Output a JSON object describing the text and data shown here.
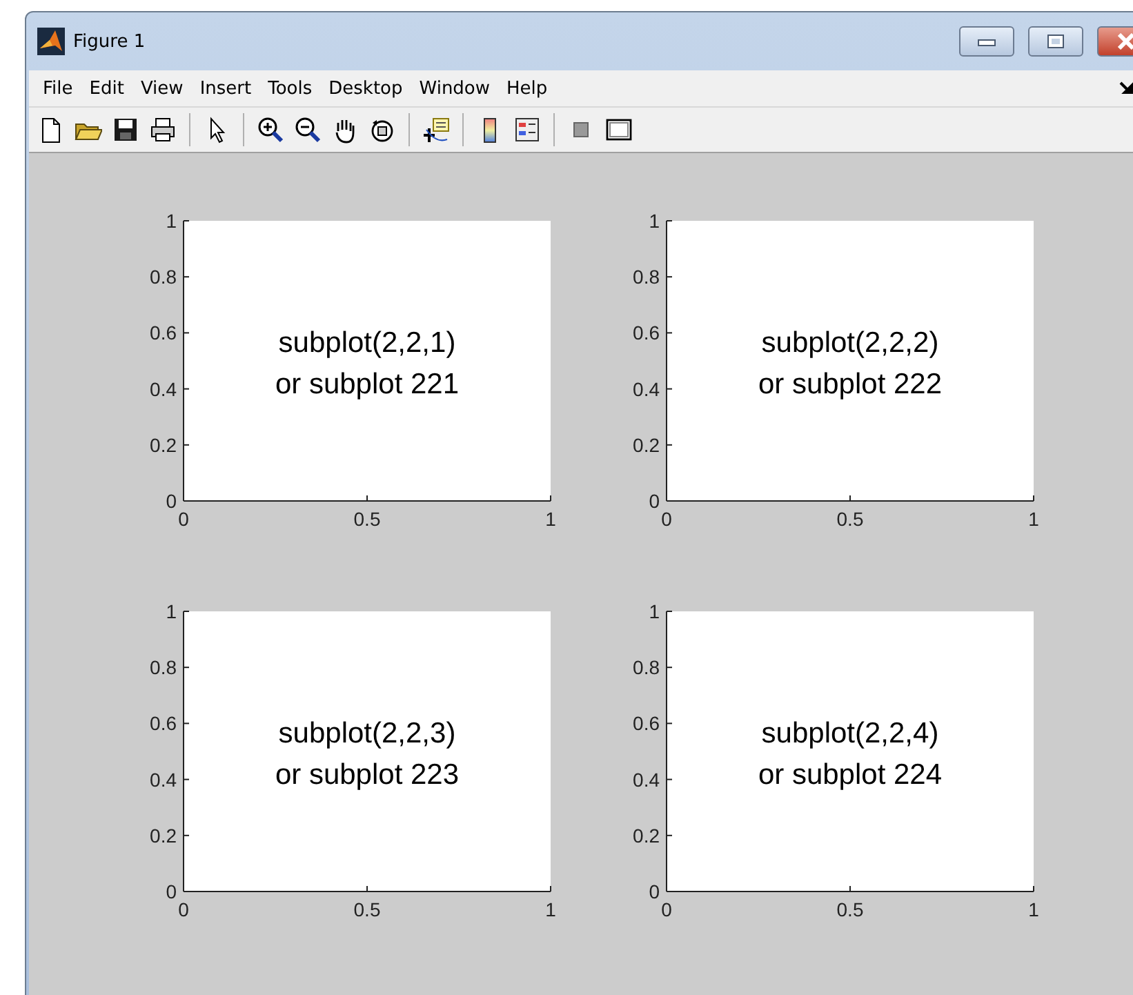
{
  "window": {
    "title": "Figure 1"
  },
  "menu": [
    "File",
    "Edit",
    "View",
    "Insert",
    "Tools",
    "Desktop",
    "Window",
    "Help"
  ],
  "axes": [
    {
      "chart_data": {
        "type": "line",
        "xlim": [
          0,
          1
        ],
        "ylim": [
          0,
          1
        ],
        "xticks": [
          0,
          0.5,
          1
        ],
        "yticks": [
          0,
          0.2,
          0.4,
          0.6,
          0.8,
          1
        ],
        "annotations": [
          "subplot(2,2,1)",
          "or subplot 221"
        ]
      }
    },
    {
      "chart_data": {
        "type": "line",
        "xlim": [
          0,
          1
        ],
        "ylim": [
          0,
          1
        ],
        "xticks": [
          0,
          0.5,
          1
        ],
        "yticks": [
          0,
          0.2,
          0.4,
          0.6,
          0.8,
          1
        ],
        "annotations": [
          "subplot(2,2,2)",
          "or subplot 222"
        ]
      }
    },
    {
      "chart_data": {
        "type": "line",
        "xlim": [
          0,
          1
        ],
        "ylim": [
          0,
          1
        ],
        "xticks": [
          0,
          0.5,
          1
        ],
        "yticks": [
          0,
          0.2,
          0.4,
          0.6,
          0.8,
          1
        ],
        "annotations": [
          "subplot(2,2,3)",
          "or subplot 223"
        ]
      }
    },
    {
      "chart_data": {
        "type": "line",
        "xlim": [
          0,
          1
        ],
        "ylim": [
          0,
          1
        ],
        "xticks": [
          0,
          0.5,
          1
        ],
        "yticks": [
          0,
          0.2,
          0.4,
          0.6,
          0.8,
          1
        ],
        "annotations": [
          "subplot(2,2,4)",
          "or subplot 224"
        ]
      }
    }
  ]
}
